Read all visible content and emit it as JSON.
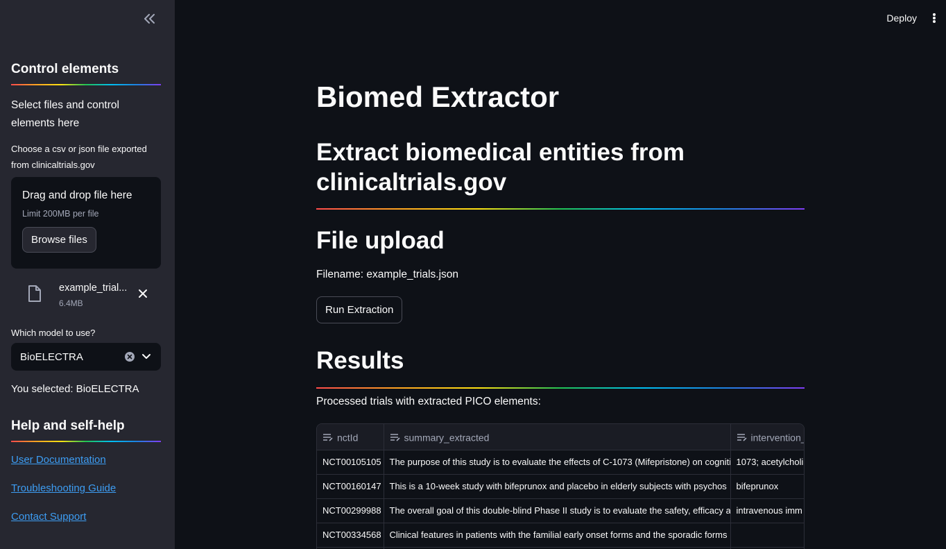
{
  "sidebar": {
    "control_heading": "Control elements",
    "intro_text": "Select files and control elements here",
    "upload_label": "Choose a csv or json file exported from clinicaltrials.gov",
    "dropzone_title": "Drag and drop file here",
    "dropzone_limit": "Limit 200MB per file",
    "browse_label": "Browse files",
    "file": {
      "name": "example_trial...",
      "size": "6.4MB"
    },
    "model_label": "Which model to use?",
    "model_value": "BioELECTRA",
    "selected_text": "You selected: BioELECTRA",
    "help_heading": "Help and self-help",
    "links": [
      "User Documentation",
      "Troubleshooting Guide",
      "Contact Support"
    ]
  },
  "header": {
    "deploy_label": "Deploy"
  },
  "main": {
    "title": "Biomed Extractor",
    "subtitle": "Extract biomedical entities from clinicaltrials.gov",
    "upload_heading": "File upload",
    "filename_text": "Filename: example_trials.json",
    "run_label": "Run Extraction",
    "results_heading": "Results",
    "processed_text": "Processed trials with extracted PICO elements:"
  },
  "table": {
    "columns": [
      "nctId",
      "summary_extracted",
      "intervention_"
    ],
    "rows": [
      [
        "NCT00105105",
        "The purpose of this study is to evaluate the effects of C-1073 (Mifepristone) on cogniti",
        "1073; acetylcholi"
      ],
      [
        "NCT00160147",
        "This is a 10-week study with bifeprunox and placebo in elderly subjects with psychos",
        "bifeprunox"
      ],
      [
        "NCT00299988",
        "The overall goal of this double-blind Phase II study is to evaluate the safety, efficacy a",
        "intravenous imm"
      ],
      [
        "NCT00334568",
        "Clinical features in patients with the familial early onset forms and the sporadic forms",
        ""
      ]
    ]
  },
  "colors": {
    "background": "#0e1117",
    "sidebar": "#262730",
    "link": "#3d9df3",
    "text": "#fafafa",
    "muted": "#a3a8b8"
  }
}
